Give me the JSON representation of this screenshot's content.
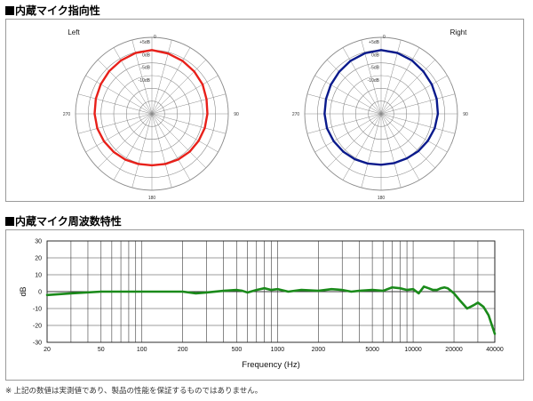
{
  "headings": {
    "polar": "内蔵マイク指向性",
    "frequency": "内蔵マイク周波数特性"
  },
  "footnote": "※ 上記の数値は実測値であり、製品の性能を保証するものではありません。",
  "chart_data": [
    {
      "type": "polar",
      "title": "Left",
      "color": "#e8201a",
      "ring_labels": [
        "+5dB",
        "0dB",
        "-5dB",
        "-10dB"
      ],
      "ring_values_db": [
        5,
        0,
        -5,
        -10
      ],
      "angle_labels": [
        "0",
        "90",
        "180",
        "270"
      ],
      "rlim_db": [
        -25,
        5
      ],
      "series": [
        {
          "angles_deg": [
            0,
            15,
            30,
            45,
            60,
            75,
            90,
            105,
            120,
            135,
            150,
            165,
            180,
            195,
            210,
            225,
            240,
            255,
            270,
            285,
            300,
            315,
            330,
            345,
            360
          ],
          "values_db": [
            0,
            -0.5,
            -1,
            -1.5,
            -2,
            -2.8,
            -3.2,
            -3.5,
            -3.8,
            -4,
            -4.3,
            -4.6,
            -4.8,
            -4.6,
            -4.2,
            -3.8,
            -3.3,
            -2.8,
            -2.5,
            -2.2,
            -1.8,
            -1.3,
            -0.8,
            -0.3,
            0
          ]
        }
      ]
    },
    {
      "type": "polar",
      "title": "Right",
      "color": "#0a1a8c",
      "ring_labels": [
        "+5dB",
        "0dB",
        "-5dB",
        "-10dB"
      ],
      "ring_values_db": [
        5,
        0,
        -5,
        -10
      ],
      "angle_labels": [
        "0",
        "90",
        "180",
        "270"
      ],
      "rlim_db": [
        -25,
        5
      ],
      "series": [
        {
          "angles_deg": [
            0,
            15,
            30,
            45,
            60,
            75,
            90,
            105,
            120,
            135,
            150,
            165,
            180,
            195,
            210,
            225,
            240,
            255,
            270,
            285,
            300,
            315,
            330,
            345,
            360
          ],
          "values_db": [
            0,
            -0.3,
            -0.8,
            -1.5,
            -2,
            -2.4,
            -2.7,
            -3.2,
            -3.8,
            -4.3,
            -4.8,
            -5,
            -5,
            -4.8,
            -4.4,
            -4,
            -3.5,
            -3,
            -2.8,
            -2.6,
            -2.2,
            -1.7,
            -1,
            -0.4,
            0
          ]
        }
      ]
    },
    {
      "type": "line",
      "xlabel": "Frequency (Hz)",
      "ylabel": "dB",
      "x_scale": "log",
      "xlim": [
        20,
        40000
      ],
      "ylim": [
        -30,
        30
      ],
      "grid": true,
      "color": "#1a8a1a",
      "x_ticks": [
        20,
        50,
        100,
        200,
        500,
        1000,
        2000,
        5000,
        10000,
        20000,
        40000
      ],
      "x_tick_labels": [
        "20",
        "50",
        "100",
        "200",
        "500",
        "1000",
        "2000",
        "5000",
        "10000",
        "20000",
        "40000"
      ],
      "y_ticks": [
        30,
        20,
        10,
        0,
        -10,
        -20,
        -30
      ],
      "y_tick_labels": [
        "30",
        "20",
        "10",
        "0",
        "-10",
        "-20",
        "-30"
      ],
      "series": [
        {
          "x": [
            20,
            30,
            50,
            100,
            150,
            200,
            250,
            300,
            400,
            500,
            550,
            600,
            700,
            800,
            900,
            1000,
            1200,
            1500,
            2000,
            2500,
            3000,
            3500,
            4000,
            5000,
            6000,
            7000,
            8000,
            9000,
            10000,
            11000,
            12000,
            13000,
            14000,
            15000,
            16000,
            17000,
            18000,
            20000,
            22000,
            25000,
            28000,
            30000,
            33000,
            36000,
            40000
          ],
          "y": [
            -2,
            -1,
            0,
            0,
            0,
            0,
            -1,
            -0.5,
            0.5,
            1,
            0.5,
            -0.5,
            1,
            2,
            1,
            1.5,
            0,
            1,
            0.5,
            1.5,
            1,
            0,
            0.5,
            1,
            0.5,
            2.5,
            2,
            1,
            1.5,
            -1,
            3,
            2,
            1,
            1,
            2,
            2.5,
            2,
            -1,
            -5,
            -10,
            -8,
            -6.5,
            -9,
            -14,
            -25
          ]
        }
      ]
    }
  ]
}
